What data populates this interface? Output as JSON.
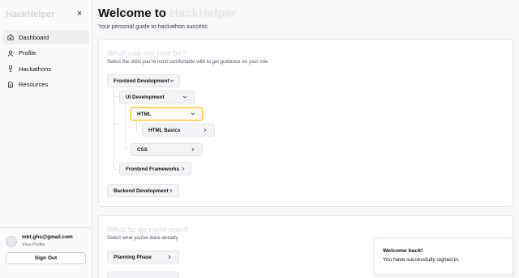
{
  "sidebar": {
    "logo": "HackHelper",
    "close_label": "×",
    "items": [
      {
        "label": "Dashboard",
        "icon": "home-icon"
      },
      {
        "label": "Profile",
        "icon": "user-icon"
      },
      {
        "label": "Hackathons",
        "icon": "trophy-icon"
      },
      {
        "label": "Resources",
        "icon": "document-icon"
      }
    ],
    "user_email": "mbt.ghs@gmail.com",
    "view_profile": "View Profile",
    "signout_label": "Sign Out"
  },
  "header": {
    "title_prefix": "Welcome to ",
    "title_brand": "HackHelper",
    "subtitle": "Your personal guide to hackathon success"
  },
  "role_card": {
    "title": "What can my role be?",
    "subtitle": "Select the skills you're most comfortable with to get guidance on your role",
    "nodes": {
      "frontend": "Frontend Development",
      "ui": "UI Development",
      "html": "HTML",
      "html_basics": "HTML Basics",
      "css": "CSS",
      "frameworks": "Frontend Frameworks",
      "backend": "Backend Development"
    }
  },
  "todo_card": {
    "title": "What to do right now?",
    "subtitle": "Select what you've done already",
    "planning": "Planning Phase"
  },
  "toast": {
    "title": "Welcome back!",
    "message": "You have successfully signed in."
  },
  "colors": {
    "selected_border": "#f6c453",
    "brand_muted": "#e5e7eb"
  }
}
